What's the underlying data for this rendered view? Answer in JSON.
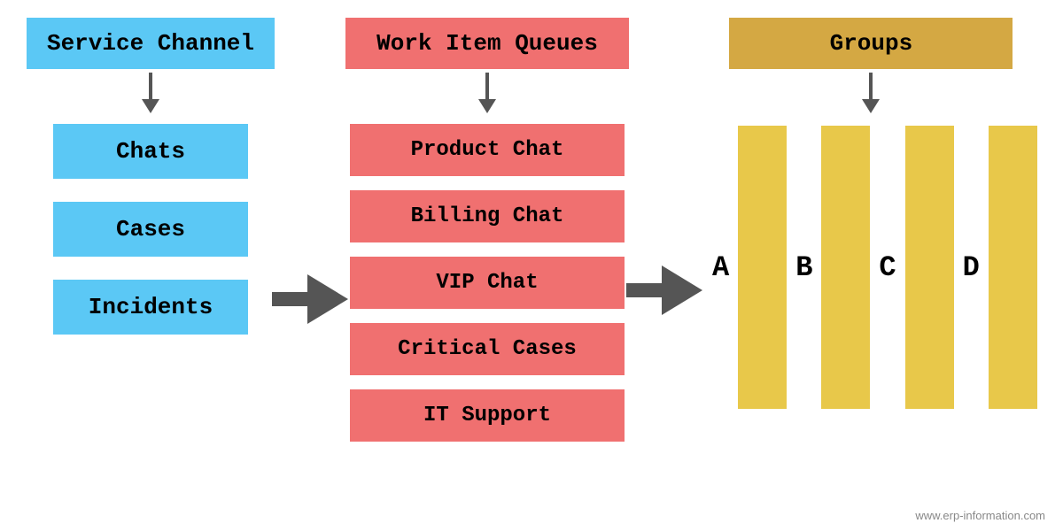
{
  "columns": {
    "col1": {
      "header": "Service Channel",
      "items": [
        "Chats",
        "Cases",
        "Incidents"
      ]
    },
    "col3": {
      "header": "Work Item Queues",
      "items": [
        "Product Chat",
        "Billing Chat",
        "VIP Chat",
        "Critical Cases",
        "IT Support"
      ]
    },
    "col5": {
      "header": "Groups",
      "bars": [
        "A",
        "B",
        "C",
        "D"
      ]
    }
  },
  "watermark": "www.erp-information.com"
}
